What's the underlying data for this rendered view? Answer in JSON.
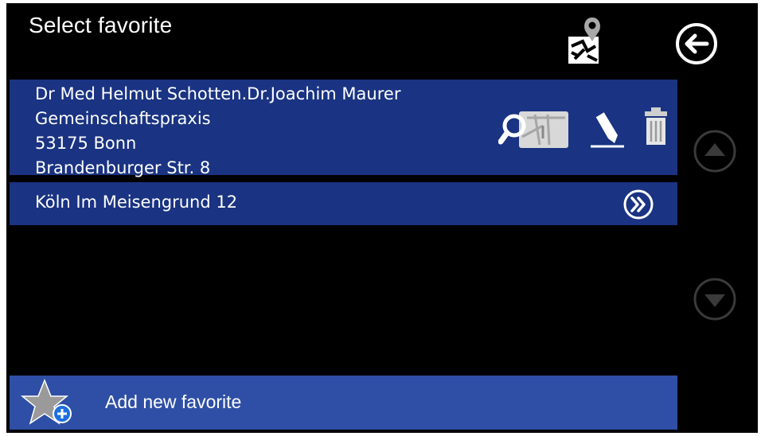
{
  "header": {
    "title": "Select favorite"
  },
  "favorites": [
    {
      "lines": [
        "Dr Med Helmut Schotten.Dr.Joachim Maurer",
        "Gemeinschaftspraxis",
        "53175 Bonn",
        "Brandenburger Str. 8"
      ]
    },
    {
      "label": "Köln Im Meisengrund 12"
    }
  ],
  "add_favorite": {
    "label": "Add new favorite"
  },
  "icons": {
    "map_destination": "map-destination-icon",
    "back": "back-arrow-icon",
    "map_search": "map-search-icon",
    "edit": "pencil-icon",
    "delete": "trash-icon",
    "open": "double-chevron-right-icon",
    "scroll_up": "scroll-up-icon",
    "scroll_down": "scroll-down-icon",
    "add": "star-plus-icon"
  },
  "colors": {
    "background": "#000000",
    "row_bg": "#1a3382",
    "add_bg": "#2e4fa5",
    "text": "#ffffff",
    "scroll_disabled": "#3a3a3a"
  }
}
